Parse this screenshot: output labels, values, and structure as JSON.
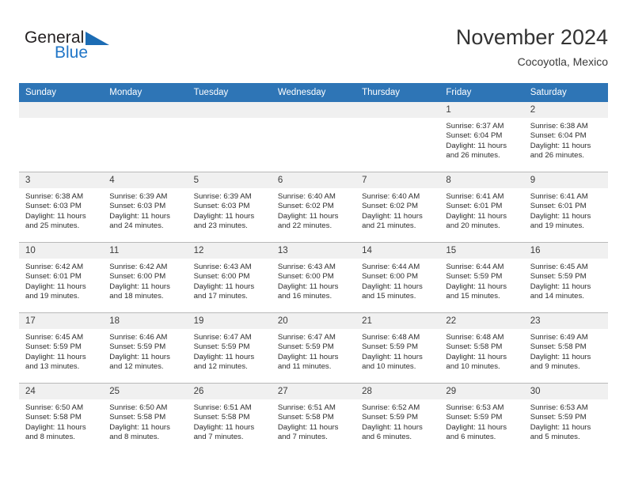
{
  "brand": {
    "name_part1": "General",
    "name_part2": "Blue",
    "flag_color": "#1c6cb4"
  },
  "header": {
    "title": "November 2024",
    "subtitle": "Cocoyotla, Mexico",
    "header_bg_color": "#2e75b6",
    "daynum_bg_color": "#f0f0f0"
  },
  "calendar": {
    "weekdays": [
      "Sunday",
      "Monday",
      "Tuesday",
      "Wednesday",
      "Thursday",
      "Friday",
      "Saturday"
    ],
    "weeks": [
      [
        {
          "day": "",
          "empty": true
        },
        {
          "day": "",
          "empty": true
        },
        {
          "day": "",
          "empty": true
        },
        {
          "day": "",
          "empty": true
        },
        {
          "day": "",
          "empty": true
        },
        {
          "day": "1",
          "sunrise": "Sunrise: 6:37 AM",
          "sunset": "Sunset: 6:04 PM",
          "daylight": "Daylight: 11 hours and 26 minutes."
        },
        {
          "day": "2",
          "sunrise": "Sunrise: 6:38 AM",
          "sunset": "Sunset: 6:04 PM",
          "daylight": "Daylight: 11 hours and 26 minutes."
        }
      ],
      [
        {
          "day": "3",
          "sunrise": "Sunrise: 6:38 AM",
          "sunset": "Sunset: 6:03 PM",
          "daylight": "Daylight: 11 hours and 25 minutes."
        },
        {
          "day": "4",
          "sunrise": "Sunrise: 6:39 AM",
          "sunset": "Sunset: 6:03 PM",
          "daylight": "Daylight: 11 hours and 24 minutes."
        },
        {
          "day": "5",
          "sunrise": "Sunrise: 6:39 AM",
          "sunset": "Sunset: 6:03 PM",
          "daylight": "Daylight: 11 hours and 23 minutes."
        },
        {
          "day": "6",
          "sunrise": "Sunrise: 6:40 AM",
          "sunset": "Sunset: 6:02 PM",
          "daylight": "Daylight: 11 hours and 22 minutes."
        },
        {
          "day": "7",
          "sunrise": "Sunrise: 6:40 AM",
          "sunset": "Sunset: 6:02 PM",
          "daylight": "Daylight: 11 hours and 21 minutes."
        },
        {
          "day": "8",
          "sunrise": "Sunrise: 6:41 AM",
          "sunset": "Sunset: 6:01 PM",
          "daylight": "Daylight: 11 hours and 20 minutes."
        },
        {
          "day": "9",
          "sunrise": "Sunrise: 6:41 AM",
          "sunset": "Sunset: 6:01 PM",
          "daylight": "Daylight: 11 hours and 19 minutes."
        }
      ],
      [
        {
          "day": "10",
          "sunrise": "Sunrise: 6:42 AM",
          "sunset": "Sunset: 6:01 PM",
          "daylight": "Daylight: 11 hours and 19 minutes."
        },
        {
          "day": "11",
          "sunrise": "Sunrise: 6:42 AM",
          "sunset": "Sunset: 6:00 PM",
          "daylight": "Daylight: 11 hours and 18 minutes."
        },
        {
          "day": "12",
          "sunrise": "Sunrise: 6:43 AM",
          "sunset": "Sunset: 6:00 PM",
          "daylight": "Daylight: 11 hours and 17 minutes."
        },
        {
          "day": "13",
          "sunrise": "Sunrise: 6:43 AM",
          "sunset": "Sunset: 6:00 PM",
          "daylight": "Daylight: 11 hours and 16 minutes."
        },
        {
          "day": "14",
          "sunrise": "Sunrise: 6:44 AM",
          "sunset": "Sunset: 6:00 PM",
          "daylight": "Daylight: 11 hours and 15 minutes."
        },
        {
          "day": "15",
          "sunrise": "Sunrise: 6:44 AM",
          "sunset": "Sunset: 5:59 PM",
          "daylight": "Daylight: 11 hours and 15 minutes."
        },
        {
          "day": "16",
          "sunrise": "Sunrise: 6:45 AM",
          "sunset": "Sunset: 5:59 PM",
          "daylight": "Daylight: 11 hours and 14 minutes."
        }
      ],
      [
        {
          "day": "17",
          "sunrise": "Sunrise: 6:45 AM",
          "sunset": "Sunset: 5:59 PM",
          "daylight": "Daylight: 11 hours and 13 minutes."
        },
        {
          "day": "18",
          "sunrise": "Sunrise: 6:46 AM",
          "sunset": "Sunset: 5:59 PM",
          "daylight": "Daylight: 11 hours and 12 minutes."
        },
        {
          "day": "19",
          "sunrise": "Sunrise: 6:47 AM",
          "sunset": "Sunset: 5:59 PM",
          "daylight": "Daylight: 11 hours and 12 minutes."
        },
        {
          "day": "20",
          "sunrise": "Sunrise: 6:47 AM",
          "sunset": "Sunset: 5:59 PM",
          "daylight": "Daylight: 11 hours and 11 minutes."
        },
        {
          "day": "21",
          "sunrise": "Sunrise: 6:48 AM",
          "sunset": "Sunset: 5:59 PM",
          "daylight": "Daylight: 11 hours and 10 minutes."
        },
        {
          "day": "22",
          "sunrise": "Sunrise: 6:48 AM",
          "sunset": "Sunset: 5:58 PM",
          "daylight": "Daylight: 11 hours and 10 minutes."
        },
        {
          "day": "23",
          "sunrise": "Sunrise: 6:49 AM",
          "sunset": "Sunset: 5:58 PM",
          "daylight": "Daylight: 11 hours and 9 minutes."
        }
      ],
      [
        {
          "day": "24",
          "sunrise": "Sunrise: 6:50 AM",
          "sunset": "Sunset: 5:58 PM",
          "daylight": "Daylight: 11 hours and 8 minutes."
        },
        {
          "day": "25",
          "sunrise": "Sunrise: 6:50 AM",
          "sunset": "Sunset: 5:58 PM",
          "daylight": "Daylight: 11 hours and 8 minutes."
        },
        {
          "day": "26",
          "sunrise": "Sunrise: 6:51 AM",
          "sunset": "Sunset: 5:58 PM",
          "daylight": "Daylight: 11 hours and 7 minutes."
        },
        {
          "day": "27",
          "sunrise": "Sunrise: 6:51 AM",
          "sunset": "Sunset: 5:58 PM",
          "daylight": "Daylight: 11 hours and 7 minutes."
        },
        {
          "day": "28",
          "sunrise": "Sunrise: 6:52 AM",
          "sunset": "Sunset: 5:59 PM",
          "daylight": "Daylight: 11 hours and 6 minutes."
        },
        {
          "day": "29",
          "sunrise": "Sunrise: 6:53 AM",
          "sunset": "Sunset: 5:59 PM",
          "daylight": "Daylight: 11 hours and 6 minutes."
        },
        {
          "day": "30",
          "sunrise": "Sunrise: 6:53 AM",
          "sunset": "Sunset: 5:59 PM",
          "daylight": "Daylight: 11 hours and 5 minutes."
        }
      ]
    ]
  }
}
